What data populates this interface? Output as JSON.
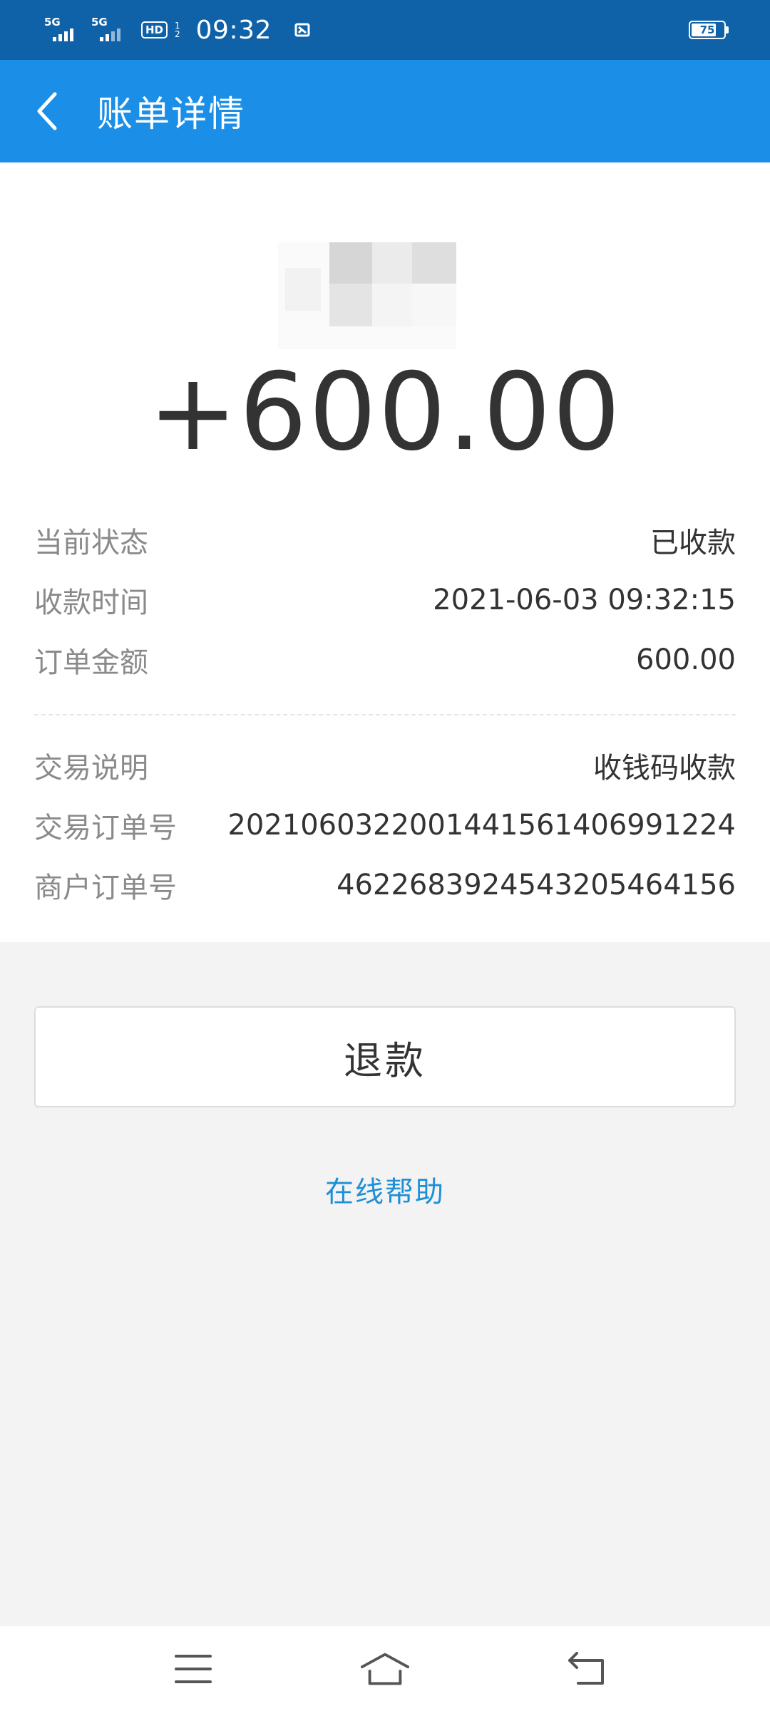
{
  "status_bar": {
    "network_1": "5G",
    "network_2": "5G",
    "hd_label": "HD",
    "hd_sub_1": "1",
    "hd_sub_2": "2",
    "time": "09:32",
    "battery_level": "75"
  },
  "header": {
    "title": "账单详情"
  },
  "summary": {
    "amount": "+600.00"
  },
  "details": [
    {
      "label": "当前状态",
      "value": "已收款"
    },
    {
      "label": "收款时间",
      "value": "2021-06-03 09:32:15"
    },
    {
      "label": "订单金额",
      "value": "600.00"
    },
    {
      "label": "交易说明",
      "value": "收钱码收款"
    },
    {
      "label": "交易订单号",
      "value": "2021060322001441561406991224"
    },
    {
      "label": "商户订单号",
      "value": "4622683924543205464156"
    }
  ],
  "actions": {
    "refund_label": "退款",
    "help_label": "在线帮助"
  },
  "colors": {
    "status_bar": "#0f62a8",
    "header": "#1b8fe8",
    "link": "#1f8fd6",
    "background": "#f3f3f3"
  },
  "icons": {
    "back": "chevron-left-icon",
    "menu": "menu-icon",
    "home": "home-icon",
    "return": "back-arrow-icon"
  }
}
